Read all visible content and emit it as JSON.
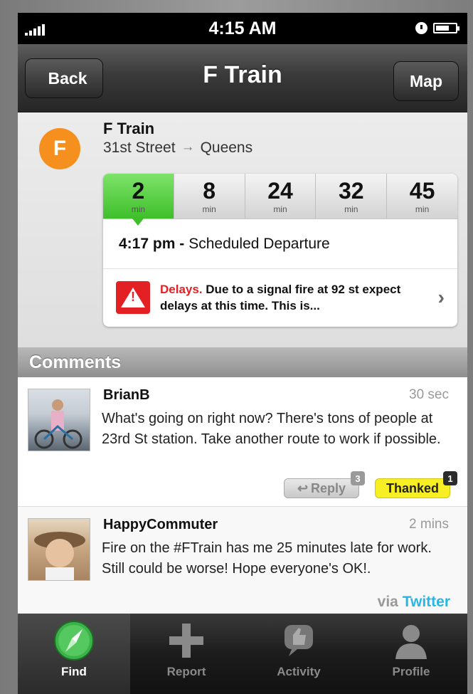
{
  "status_bar": {
    "time": "4:15 AM"
  },
  "nav": {
    "title": "F Train",
    "back_label": "Back",
    "map_label": "Map"
  },
  "train": {
    "line_letter": "F",
    "name": "F Train",
    "from": "31st Street",
    "arrow": "→",
    "to": "Queens",
    "times": [
      {
        "value": "2",
        "unit": "min"
      },
      {
        "value": "8",
        "unit": "min"
      },
      {
        "value": "24",
        "unit": "min"
      },
      {
        "value": "32",
        "unit": "min"
      },
      {
        "value": "45",
        "unit": "min"
      }
    ],
    "departure_time": "4:17 pm -",
    "departure_label": "Scheduled Departure",
    "alert_title": "Delays.",
    "alert_text": "Due to a signal fire at 92 st expect delays at this time. This is..."
  },
  "comments": {
    "header": "Comments",
    "items": [
      {
        "author": "BrianB",
        "ago": "30 sec",
        "body": "What's going on right now? There's tons of people at 23rd St station. Take another route to work if possible.",
        "reply_label": "Reply",
        "reply_count": "3",
        "thanked_label": "Thanked",
        "thanks_count": "1"
      },
      {
        "author": "HappyCommuter",
        "ago": "2 mins",
        "body": "Fire on the #FTrain has me 25 minutes late for work. Still could be worse! Hope everyone's OK!.",
        "via_label": "via",
        "via_source": "Twitter"
      }
    ]
  },
  "tabs": [
    {
      "label": "Find",
      "icon": "compass-icon",
      "active": true
    },
    {
      "label": "Report",
      "icon": "plus-icon",
      "active": false
    },
    {
      "label": "Activity",
      "icon": "thumbs-up-icon",
      "active": false
    },
    {
      "label": "Profile",
      "icon": "person-icon",
      "active": false
    }
  ],
  "colors": {
    "accent_green": "#3fbf2a",
    "line_orange": "#f5901e",
    "alert_red": "#e32124",
    "thanked_yellow": "#f7ef24",
    "twitter_blue": "#2bb5e3"
  }
}
